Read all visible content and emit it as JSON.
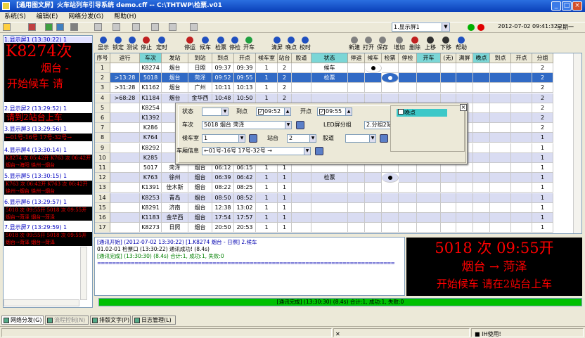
{
  "window": {
    "title": "【通用图文屏】火车站列车引导系统 demo.cff -- C:\\THTWP\\检票.v01"
  },
  "menu": [
    "系统(S)",
    "编辑(E)",
    "网络分发(G)",
    "帮助(H)"
  ],
  "topbar": {
    "screen_select": "1.显示屏1",
    "datetime": "2012-07-02 09:41:32",
    "weekday": "星期一"
  },
  "toolbar": [
    {
      "label": "显示",
      "color": "#2050c0"
    },
    {
      "label": "锁定",
      "color": "#2050c0"
    },
    {
      "label": "测试",
      "color": "#2050c0"
    },
    {
      "label": "停止",
      "color": "#c02020"
    },
    {
      "label": "定时",
      "color": "#2050c0"
    },
    {
      "label": "停运",
      "color": "#c02020"
    },
    {
      "label": "候车",
      "color": "#2050c0"
    },
    {
      "label": "检票",
      "color": "#2050c0"
    },
    {
      "label": "停检",
      "color": "#2050c0"
    },
    {
      "label": "开车",
      "color": "#20a040"
    },
    {
      "label": "清屏",
      "color": "#2050c0"
    },
    {
      "label": "晚点",
      "color": "#2050c0"
    },
    {
      "label": "校时",
      "color": "#2050c0"
    },
    {
      "label": "新建",
      "color": "#808080"
    },
    {
      "label": "打开",
      "color": "#808080"
    },
    {
      "label": "保存",
      "color": "#808080"
    },
    {
      "label": "增加",
      "color": "#808080"
    },
    {
      "label": "删除",
      "color": "#c02020"
    },
    {
      "label": "上移",
      "color": "#303030"
    },
    {
      "label": "下移",
      "color": "#303030"
    },
    {
      "label": "帮助",
      "color": "#2050c0"
    }
  ],
  "left_screens": [
    {
      "header": "1.显示屏1 (13:30:22) 1",
      "lines": [
        "K8274次",
        "烟台 -",
        "开始候车 请"
      ]
    },
    {
      "header": "2.显示屏2 (13:29:52) 1",
      "lines": [
        "请到2站台上车"
      ]
    },
    {
      "header": "3.显示屏3 (13:29:56) 1",
      "lines": [
        "←01号-16号 17号-32号→"
      ]
    },
    {
      "header": "4.显示屏4 (13:30:14) 1",
      "lines": [
        "K8274 次 05:42开 K763 次 06:42开",
        "烟台→海阳  徐州→烟台"
      ]
    },
    {
      "header": "5.显示屏5 (13:30:15) 1",
      "lines": [
        "K763 次 06:42开 K763 次 06:42开",
        "徐州→烟台  徐州→烟台"
      ]
    },
    {
      "header": "6.显示屏6 (13:29:57) 1",
      "lines": [
        "5018 次 09:55开 5018 次 09:55开",
        "烟台→菏泽  烟台→菏泽"
      ]
    },
    {
      "header": "7.显示屏7 (13:29:59) 1",
      "lines": [
        "5018 次 09:55开 5018 次 09:55开",
        "烟台→菏泽  烟台→菏泽"
      ]
    }
  ],
  "grid": {
    "headers": [
      "序号",
      "运行",
      "车次",
      "发站",
      "到站",
      "到点",
      "开点",
      "候车室",
      "站台",
      "股道",
      "状态",
      "停运",
      "候车",
      "检票",
      "停检",
      "开车",
      "(无)",
      "满屏",
      "晚点",
      "到点",
      "开点",
      "分组"
    ],
    "rows": [
      [
        "1",
        "",
        "K8274",
        "烟台",
        "日照",
        "09:37",
        "09:39",
        "1",
        "2",
        "",
        "候车",
        "",
        "●",
        "",
        "",
        "",
        "",
        "",
        "",
        "",
        "",
        "2"
      ],
      [
        "2",
        ">13:28",
        "5018",
        "烟台",
        "菏泽",
        "09:52",
        "09:55",
        "1",
        "2",
        "",
        "检票",
        "",
        "",
        "●",
        "",
        "",
        "",
        "",
        "",
        "",
        "",
        "2"
      ],
      [
        "3",
        ">31:28",
        "K1162",
        "烟台",
        "广州",
        "10:11",
        "10:13",
        "1",
        "2",
        "",
        "",
        "",
        "",
        "",
        "",
        "",
        "",
        "",
        "",
        "",
        "",
        "2"
      ],
      [
        "4",
        ">68:28",
        "K1184",
        "烟台",
        "金华西",
        "10:48",
        "10:50",
        "1",
        "2",
        "",
        "",
        "",
        "",
        "",
        "",
        "",
        "",
        "",
        "",
        "",
        "",
        "2"
      ],
      [
        "5",
        "",
        "K8254",
        "",
        "",
        "",
        "",
        "",
        "",
        "",
        "",
        "",
        "",
        "",
        "",
        "",
        "",
        "",
        "",
        "",
        "",
        "2"
      ],
      [
        "6",
        "",
        "K1392",
        "",
        "",
        "",
        "",
        "",
        "",
        "",
        "",
        "",
        "",
        "",
        "",
        "",
        "",
        "",
        "",
        "",
        "",
        "2"
      ],
      [
        "7",
        "",
        "K286",
        "",
        "",
        "",
        "",
        "",
        "",
        "",
        "",
        "",
        "",
        "",
        "",
        "",
        "",
        "",
        "",
        "",
        "",
        "2"
      ],
      [
        "8",
        "",
        "K764",
        "",
        "",
        "",
        "",
        "",
        "",
        "",
        "",
        "",
        "",
        "",
        "",
        "",
        "",
        "",
        "",
        "",
        "",
        "1"
      ],
      [
        "9",
        "",
        "K8292",
        "",
        "",
        "",
        "",
        "",
        "",
        "",
        "",
        "",
        "",
        "",
        "",
        "",
        "",
        "",
        "",
        "",
        "",
        "1"
      ],
      [
        "10",
        "",
        "K285",
        "",
        "",
        "",
        "",
        "",
        "",
        "",
        "",
        "",
        "",
        "",
        "",
        "",
        "",
        "",
        "",
        "",
        "",
        "1"
      ],
      [
        "11",
        "",
        "5017",
        "菏泽",
        "烟台",
        "06:12",
        "06:15",
        "1",
        "1",
        "",
        "",
        "",
        "",
        "",
        "",
        "",
        "",
        "",
        "",
        "",
        "",
        "1"
      ],
      [
        "12",
        "",
        "K763",
        "徐州",
        "烟台",
        "06:39",
        "06:42",
        "1",
        "1",
        "",
        "检票",
        "",
        "",
        "●",
        "",
        "",
        "",
        "",
        "",
        "",
        "",
        "1"
      ],
      [
        "13",
        "",
        "K1391",
        "佳木斯",
        "烟台",
        "08:22",
        "08:25",
        "1",
        "1",
        "",
        "",
        "",
        "",
        "",
        "",
        "",
        "",
        "",
        "",
        "",
        "",
        "1"
      ],
      [
        "14",
        "",
        "K8253",
        "青岛",
        "烟台",
        "08:50",
        "08:52",
        "1",
        "1",
        "",
        "",
        "",
        "",
        "",
        "",
        "",
        "",
        "",
        "",
        "",
        "",
        "1"
      ],
      [
        "15",
        "",
        "K8291",
        "济南",
        "烟台",
        "12:38",
        "13:02",
        "1",
        "1",
        "",
        "",
        "",
        "",
        "",
        "",
        "",
        "",
        "",
        "",
        "",
        "",
        "1"
      ],
      [
        "16",
        "",
        "K1183",
        "金华西",
        "烟台",
        "17:54",
        "17:57",
        "1",
        "1",
        "",
        "",
        "",
        "",
        "",
        "",
        "",
        "",
        "",
        "",
        "",
        "",
        "1"
      ],
      [
        "17",
        "",
        "K8273",
        "日照",
        "烟台",
        "20:50",
        "20:53",
        "1",
        "1",
        "",
        "",
        "",
        "",
        "",
        "",
        "",
        "",
        "",
        "",
        "",
        "",
        "1"
      ]
    ]
  },
  "dialog": {
    "status_label": "状态",
    "arrive_label": "到点",
    "arrive_value": "09:52",
    "depart_label": "开点",
    "depart_value": "09:55",
    "train_label": "车次",
    "train_value": "5018 烟台 菏泽",
    "led_group_label": "LED屏分组",
    "led_group_value": "2.分组2站台",
    "waiting_label": "候车室",
    "waiting_value": "1",
    "platform_label": "站台",
    "platform_value": "2",
    "track_label": "股道",
    "track_value": "",
    "screen_info_label": "车厢信息",
    "screen_info_value": "←01号-16号 17号-32号 →",
    "late_label": "晚点"
  },
  "log": [
    {
      "cls": "b",
      "text": "[通讯开始] (2012-07-02 13:30:22) [1.K8274 烟台 - 日照] 2.候车"
    },
    {
      "cls": "",
      "text": "01.02-01 检票口 (13:30:22) 通讯成功! (8.4s)"
    },
    {
      "cls": "g",
      "text": "[通讯完成] (13:30:30) (8.4s) 合计:1, 成功:1, 失败:0"
    },
    {
      "cls": "sep",
      "text": "================================================================================"
    }
  ],
  "big_led": {
    "line1": "5018 次 09:55开",
    "line2": "烟台 → 菏泽",
    "line3": "开始候车 请在2站台上车"
  },
  "progress": {
    "text": "[通讯完成] (13:30:30) (8.4s) 合计:1, 成功:1, 失败:0",
    "fraction": 1.0
  },
  "tabs": [
    "网络分发(G)",
    "流程控制(N)",
    "排版文字(P)",
    "日志管理(L)"
  ],
  "status": {
    "user": "IH使用!"
  }
}
